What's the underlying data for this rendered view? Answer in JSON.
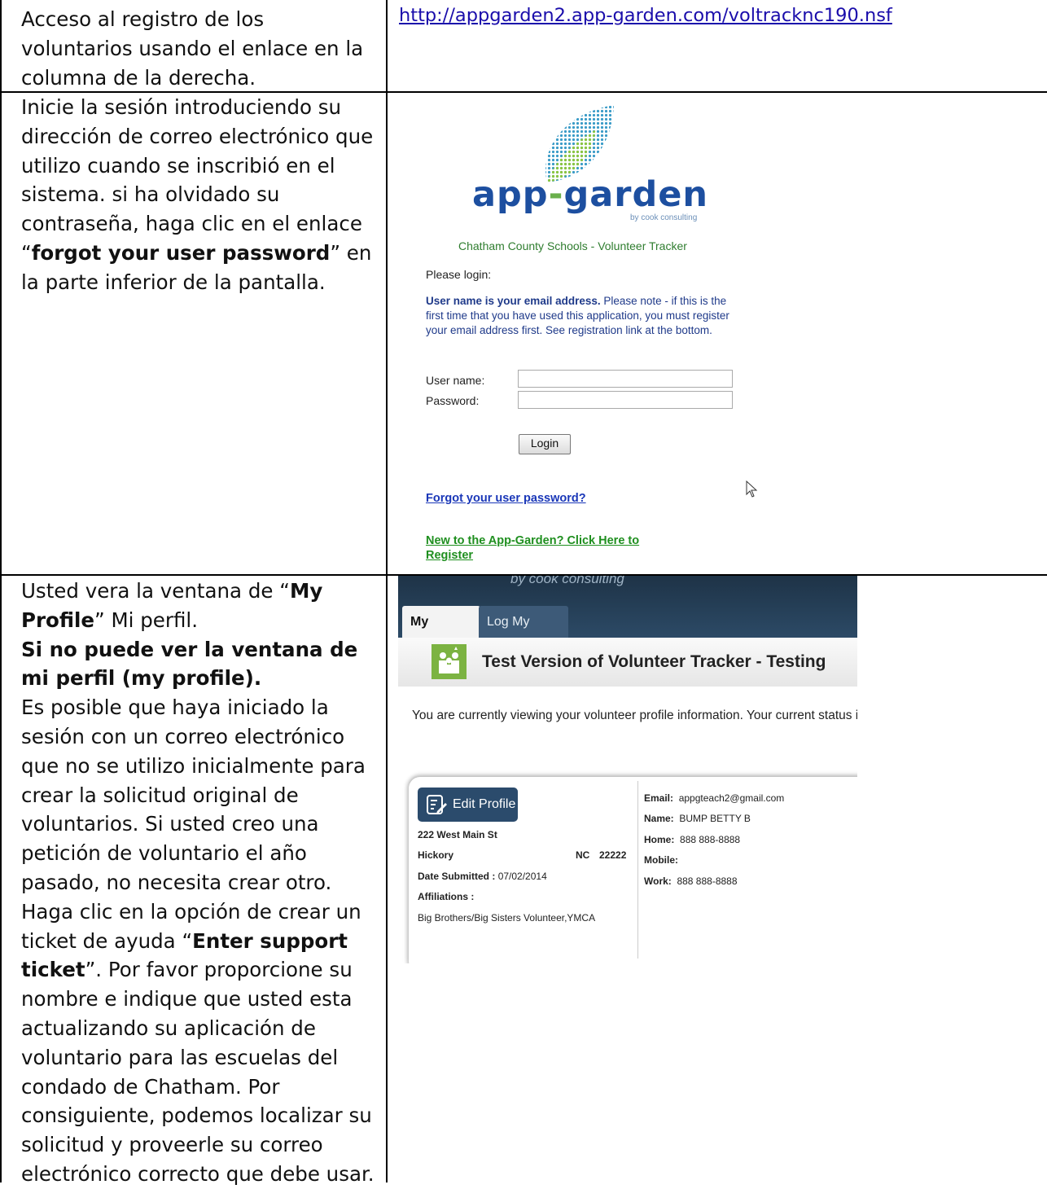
{
  "row1": {
    "text": "Acceso al registro de los voluntarios usando el enlace en la columna de la derecha.",
    "link": "http://appgarden2.app-garden.com/voltracknc190.nsf"
  },
  "row2": {
    "text_before": "Inicie la sesión introduciendo su dirección de correo electrónico que utilizo cuando se inscribió en el sistema. si ha olvidado su contraseña, haga clic en el enlace “",
    "text_bold": "forgot your user password",
    "text_after": "” en la parte inferior de la pantalla."
  },
  "login": {
    "brand_a": "app",
    "brand_dash": "-",
    "brand_b": "garden",
    "byline": "by cook consulting",
    "app_title": "Chatham County Schools - Volunteer Tracker",
    "please": "Please login:",
    "note_bold": "User name is your email address.",
    "note_rest": " Please note - if this is the first time that you have used this application, you must register your email address first. See registration link at the bottom.",
    "user_label": "User name:",
    "pass_label": "Password:",
    "login_button": "Login",
    "forgot_link": "Forgot your user password?",
    "register_link": "New to the App-Garden? Click Here to Register"
  },
  "row3": {
    "p1_a": "Usted vera la ventana de “",
    "p1_bold": "My Profile",
    "p1_b": "” Mi perfil.",
    "p2_bold": "Si no puede ver la ventana de mi perfil (my profile).",
    "p3_a": "Es posible que haya iniciado la sesión con un correo electrónico que no se utilizo inicialmente para crear la solicitud original de voluntarios. Si usted creo una petición de voluntario el año pasado, no necesita crear otro. Haga clic en la opción de crear un ticket de ayuda “",
    "p3_bold": "Enter support ticket",
    "p3_b": "”. Por favor proporcione su nombre e indique que usted esta actualizando su aplicación de voluntario para las escuelas del condado de Chatham. Por consiguiente, podemos localizar su solicitud y proveerle su correo electrónico correcto que debe usar."
  },
  "profile": {
    "byline": "by cook consulting",
    "tab_profile": "My Profile",
    "tab_time": "Log My Time",
    "title": "Test Version of Volunteer Tracker - Testing",
    "viewing": "You are currently viewing your volunteer profile information. Your current status is",
    "edit_button": "Edit Profile",
    "street": "222 West Main St",
    "city": "Hickory",
    "state": "NC",
    "zip": "22222",
    "date_label": "Date Submitted :",
    "date_value": "07/02/2014",
    "affiliations_label": "Affiliations :",
    "affiliations_value": "Big Brothers/Big Sisters Volunteer,YMCA",
    "email_label": "Email:",
    "email_value": "appgteach2@gmail.com",
    "name_label": "Name:",
    "name_value": "BUMP BETTY B",
    "home_label": "Home:",
    "home_value": "888 888-8888",
    "mobile_label": "Mobile:",
    "mobile_value": "",
    "work_label": "Work:",
    "work_value": "888 888-8888"
  }
}
